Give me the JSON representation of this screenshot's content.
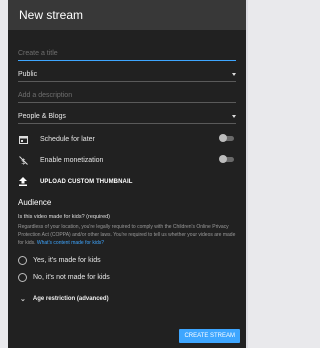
{
  "dialog": {
    "title": "New stream"
  },
  "form": {
    "title_placeholder": "Create a title",
    "visibility": "Public",
    "description_placeholder": "Add a description",
    "category": "People & Blogs"
  },
  "options": {
    "schedule_label": "Schedule for later",
    "schedule_on": false,
    "monetization_label": "Enable monetization",
    "monetization_on": false,
    "upload_label": "UPLOAD CUSTOM THUMBNAIL"
  },
  "audience": {
    "title": "Audience",
    "question": "Is this video made for kids? (required)",
    "description": "Regardless of your location, you're legally required to comply with the Children's Online Privacy Protection Act (COPPA) and/or other laws. You're required to tell us whether your videos are made for kids.",
    "link": "What's content made for kids?",
    "option_yes": "Yes, it's made for kids",
    "option_no": "No, it's not made for kids",
    "age_restriction": "Age restriction (advanced)"
  },
  "footer": {
    "create_label": "CREATE STREAM"
  },
  "colors": {
    "accent": "#3ea6ff",
    "panel": "#212121",
    "header": "#383838"
  },
  "icons": {
    "schedule": "calendar-icon",
    "monetization": "dollar-off-icon",
    "upload": "upload-icon",
    "expand": "chevron-down-icon"
  }
}
